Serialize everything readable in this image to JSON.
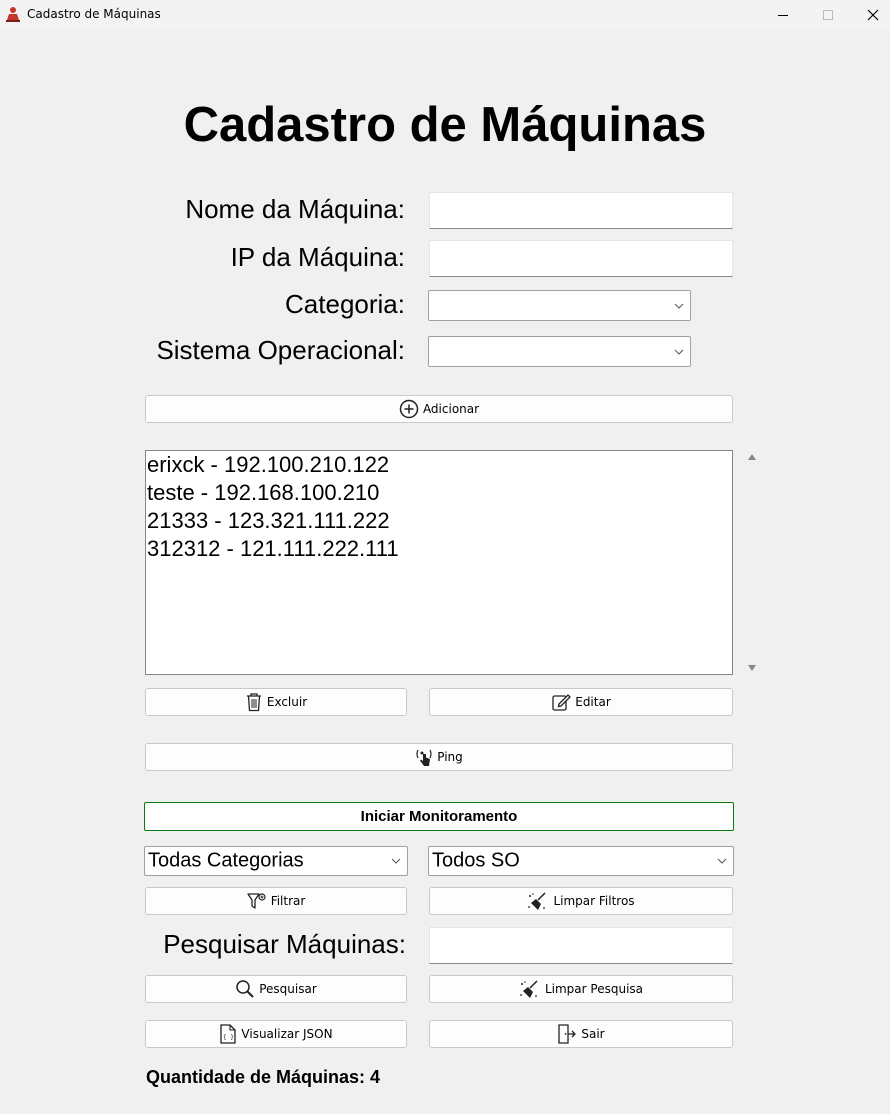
{
  "window": {
    "title": "Cadastro de Máquinas"
  },
  "heading": "Cadastro de Máquinas",
  "form": {
    "name_label": "Nome da Máquina:",
    "name_value": "",
    "ip_label": "IP da Máquina:",
    "ip_value": "",
    "category_label": "Categoria:",
    "category_value": "",
    "os_label": "Sistema Operacional:",
    "os_value": ""
  },
  "buttons": {
    "add": "Adicionar",
    "delete": "Excluir",
    "edit": "Editar",
    "ping": "Ping",
    "monitor": "Iniciar Monitoramento",
    "filter": "Filtrar",
    "clear_filters": "Limpar Filtros",
    "search": "Pesquisar",
    "clear_search": "Limpar Pesquisa",
    "view_json": "Visualizar JSON",
    "exit": "Sair"
  },
  "machines": [
    "erixck - 192.100.210.122",
    "teste - 192.168.100.210",
    "21333 - 123.321.111.222",
    "312312 - 121.111.222.111"
  ],
  "filters": {
    "category_value": "Todas Categorias",
    "os_value": "Todos SO"
  },
  "search": {
    "label": "Pesquisar Máquinas:",
    "value": ""
  },
  "count_text": "Quantidade de Máquinas: 4",
  "colors": {
    "monitor_border": "#0c7a0c",
    "background": "#f0f0f0"
  }
}
